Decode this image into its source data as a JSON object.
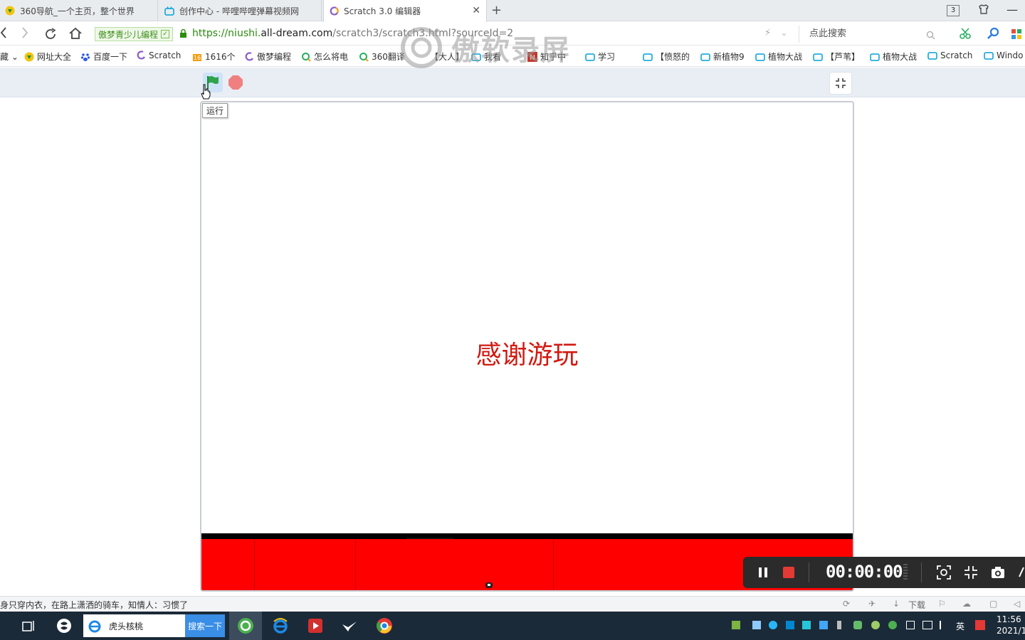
{
  "browser": {
    "tabs": [
      {
        "label": "360导航_一个主页，整个世界",
        "icon": "360-nav-icon"
      },
      {
        "label": "创作中心 - 哔哩哔哩弹幕视频网",
        "icon": "bilibili-icon"
      },
      {
        "label": "Scratch 3.0 编辑器",
        "icon": "scratch-icon",
        "active": true
      }
    ],
    "tab_count_badge": "3",
    "address": {
      "site_badge": "傲梦青少儿编程",
      "url_prefix": "https://niushi.",
      "url_domain": "all-dream.com",
      "url_path": "/scratch3/scratch3.html?sourceId=2",
      "search_placeholder": "点此搜索"
    },
    "bookmarks": [
      {
        "label": "藏 ⌄",
        "icon": "none"
      },
      {
        "label": "网址大全",
        "icon": "360-icon"
      },
      {
        "label": "百度一下",
        "icon": "baidu-paw-icon"
      },
      {
        "label": "Scratch",
        "icon": "scratch-icon"
      },
      {
        "label": "1616个",
        "icon": "folder-icon"
      },
      {
        "label": "傲梦编程",
        "icon": "scratch-icon"
      },
      {
        "label": "怎么将电",
        "icon": "search-ring-icon"
      },
      {
        "label": "360翻译",
        "icon": "search-ring-icon"
      },
      {
        "label": "【大人】",
        "icon": "bilibili-icon"
      },
      {
        "label": "我看",
        "icon": "bilibili-icon"
      },
      {
        "label": "知乎中",
        "icon": "zhihu-icon"
      },
      {
        "label": "学习",
        "icon": "bilibili-icon"
      },
      {
        "label": "【愤怒的",
        "icon": "bilibili-icon"
      },
      {
        "label": "新植物9",
        "icon": "bilibili-icon"
      },
      {
        "label": "植物大战",
        "icon": "bilibili-icon"
      },
      {
        "label": "【芦苇】",
        "icon": "bilibili-icon"
      },
      {
        "label": "植物大战",
        "icon": "bilibili-icon"
      },
      {
        "label": "Scratch",
        "icon": "bilibili-icon"
      },
      {
        "label": "Windo",
        "icon": "bilibili-icon"
      }
    ]
  },
  "scratch": {
    "run_tooltip": "运行",
    "stage_message": "感谢游玩",
    "colors": {
      "message": "#d11a12",
      "ground": "#ff0000",
      "ground_line": "#000000",
      "flag": "#2ea44f",
      "stop": "#f08080"
    }
  },
  "recorder": {
    "timer": "00:00:00",
    "watermark": "傲软录屏"
  },
  "status": {
    "marquee": "身只穿内衣，在路上潇洒的骑车，知情人：习惯了",
    "download_label": "下载"
  },
  "taskbar": {
    "search_value": "虎头核桃",
    "search_button": "搜索一下",
    "ime": "英",
    "clock_time": "11:56",
    "clock_date": "2021/1"
  }
}
